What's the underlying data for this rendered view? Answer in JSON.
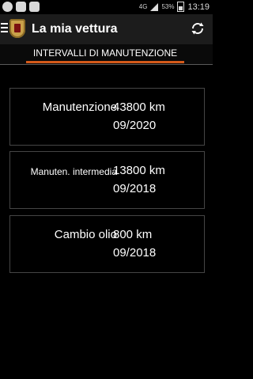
{
  "status_bar": {
    "network": "4G",
    "battery": "53%",
    "time": "13:19"
  },
  "app_bar": {
    "title": "La mia vettura"
  },
  "tabs": [
    {
      "label": "INTERVALLI DI MANUTENZIONE",
      "selected": true
    }
  ],
  "accent_color": "#d55a1a",
  "intervals": [
    {
      "label": "Manutenzione",
      "km": "43800  km",
      "date": "09/2020"
    },
    {
      "label": "Manuten. intermedia",
      "km": "13800  km",
      "date": "09/2018"
    },
    {
      "label": "Cambio olio",
      "km": "800  km",
      "date": "09/2018"
    }
  ]
}
